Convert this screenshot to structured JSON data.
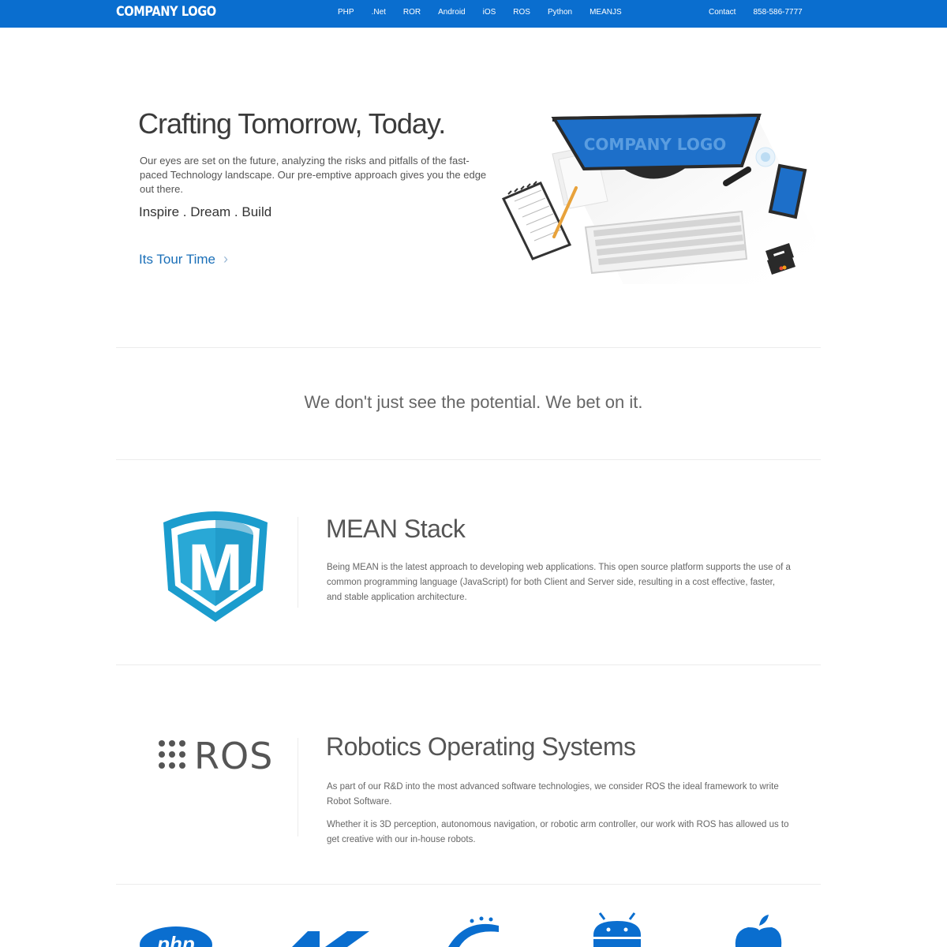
{
  "brand": {
    "logo": "COMPANY LOGO",
    "accent": "#0a6ecf",
    "link_color": "#1a6fb8",
    "mean_color": "#29a8d6"
  },
  "nav": {
    "items": [
      {
        "label": "PHP"
      },
      {
        "label": ".Net"
      },
      {
        "label": "ROR"
      },
      {
        "label": "Android"
      },
      {
        "label": "iOS"
      },
      {
        "label": "ROS"
      },
      {
        "label": "Python"
      },
      {
        "label": "MEANJS"
      }
    ],
    "contact": "Contact",
    "phone": "858-586-7777"
  },
  "hero": {
    "title": "Crafting Tomorrow, Today.",
    "text": "Our eyes are set on the future, analyzing the risks and pitfalls of the fast-paced Technology landscape. Our pre-emptive approach gives you the edge out there.",
    "tagline": "Inspire . Dream . Build",
    "cta": "Its Tour Time",
    "illustration": {
      "screen_logo": "COMPANY LOGO"
    }
  },
  "slogan": "We don't just see the potential. We bet on it.",
  "sections": {
    "mean": {
      "logo_letter": "M",
      "title": "MEAN Stack",
      "text": "Being MEAN is the latest approach to developing web applications. This open source platform supports the use of a common programming language (JavaScript) for both Client and Server side, resulting in a cost effective, faster, and stable application architecture."
    },
    "ros": {
      "logo_text": "ROS",
      "title": "Robotics Operating Systems",
      "paragraphs": [
        "As part of our R&D into the most advanced software technologies, we consider ROS the ideal framework to write Robot Software.",
        "Whether it is 3D perception, autonomous navigation, or robotic arm controller, our work with ROS has allowed us to get creative with our in-house robots."
      ]
    }
  },
  "tech_icons": [
    {
      "icon": "php-icon",
      "label": "php"
    },
    {
      "icon": "dotnet-icon"
    },
    {
      "icon": "rails-icon"
    },
    {
      "icon": "android-icon"
    },
    {
      "icon": "apple-icon"
    }
  ]
}
